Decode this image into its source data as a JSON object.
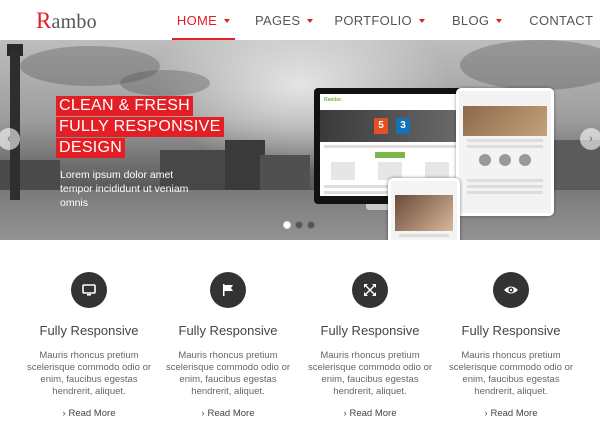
{
  "header": {
    "logo_first": "R",
    "logo_rest": "ambo",
    "nav": [
      {
        "label": "HOME",
        "active": true
      },
      {
        "label": "PAGES",
        "active": false
      },
      {
        "label": "PORTFOLIO",
        "active": false
      },
      {
        "label": "BLOG",
        "active": false
      },
      {
        "label": "CONTACT",
        "active": false
      }
    ]
  },
  "slider": {
    "headline": [
      "CLEAN & FRESH",
      "FULLY RESPONSIVE",
      "DESIGN"
    ],
    "text": "Lorem ipsum dolor amet tempor incididunt ut veniam omnis",
    "arrow_left": "‹",
    "arrow_right": "›",
    "active_slide": 1,
    "slide_count": 3
  },
  "devices": {
    "monitor_logo": "Rambo",
    "html5_label": "5",
    "css3_label": "3"
  },
  "features": [
    {
      "icon": "monitor-icon",
      "title": "Fully Responsive",
      "desc": "Mauris rhoncus pretium scelerisque commodo odio or enim, faucibus egestas hendrerit, aliquet.",
      "link": "Read More"
    },
    {
      "icon": "flag-icon",
      "title": "Fully Responsive",
      "desc": "Mauris rhoncus pretium scelerisque commodo odio or enim, faucibus egestas hendrerit, aliquet.",
      "link": "Read More"
    },
    {
      "icon": "expand-arrows-icon",
      "title": "Fully Responsive",
      "desc": "Mauris rhoncus pretium scelerisque commodo odio or enim, faucibus egestas hendrerit, aliquet.",
      "link": "Read More"
    },
    {
      "icon": "eye-icon",
      "title": "Fully Responsive",
      "desc": "Mauris rhoncus pretium scelerisque commodo odio or enim, faucibus egestas hendrerit, aliquet.",
      "link": "Read More"
    }
  ],
  "colors": {
    "accent": "#e31e24",
    "icon_bg": "#333333"
  }
}
